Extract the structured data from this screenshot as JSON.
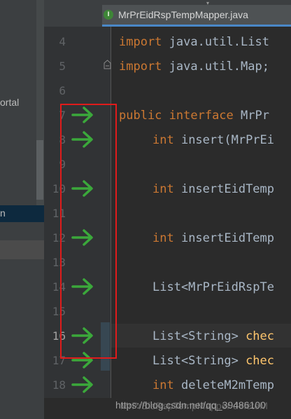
{
  "editor": {
    "tab": {
      "label": "MrPrEidRspTempMapper.java",
      "icon_glyph": "I",
      "icon_name": "interface-file-icon"
    }
  },
  "project_panel": {
    "partial_item_1": "ortal",
    "selected_item_partial": "n"
  },
  "gutter": {
    "line_numbers": [
      "4",
      "5",
      "6",
      "7",
      "8",
      "9",
      "10",
      "11",
      "12",
      "13",
      "14",
      "15",
      "16",
      "17",
      "18"
    ],
    "current_line": "16",
    "run_icons_on_lines": [
      "7",
      "8",
      "10",
      "12",
      "14",
      "16",
      "17",
      "18"
    ],
    "run_icon_name": "implemented-method-arrow-icon",
    "highlight_color": "#e01b1b"
  },
  "code": {
    "line4": {
      "kw": "import",
      "rest": " java.util.List"
    },
    "line5": {
      "kw": "import",
      "rest": " java.util.Map;"
    },
    "line7": {
      "kw1": "public",
      "kw2": " interface",
      "rest": " MrPr"
    },
    "line8": {
      "kw": "int",
      "rest": " insert(MrPrEi"
    },
    "line10": {
      "kw": "int",
      "rest": " insertEidTemp"
    },
    "line12": {
      "kw": "int",
      "rest": " insertEidTemp"
    },
    "line14": {
      "rest": "List<MrPrEidRspTe"
    },
    "line16": {
      "type": "List<String>",
      "method": " chec"
    },
    "line17": {
      "type": "List<String>",
      "method": " chec"
    },
    "line18": {
      "kw": "int",
      "rest": " deleteM2mTemp"
    }
  },
  "watermark": {
    "text": "https://blog.csdn.net/qq_39486100",
    "ghost_text": "MrPrEidRspTempMapper  deleteM"
  },
  "colors": {
    "keyword": "#cc7832",
    "identifier": "#a9b7c6",
    "method_call": "#ffc66d",
    "run_icon": "#3ba83b",
    "background": "#2b2b2b",
    "gutter": "#313335"
  }
}
